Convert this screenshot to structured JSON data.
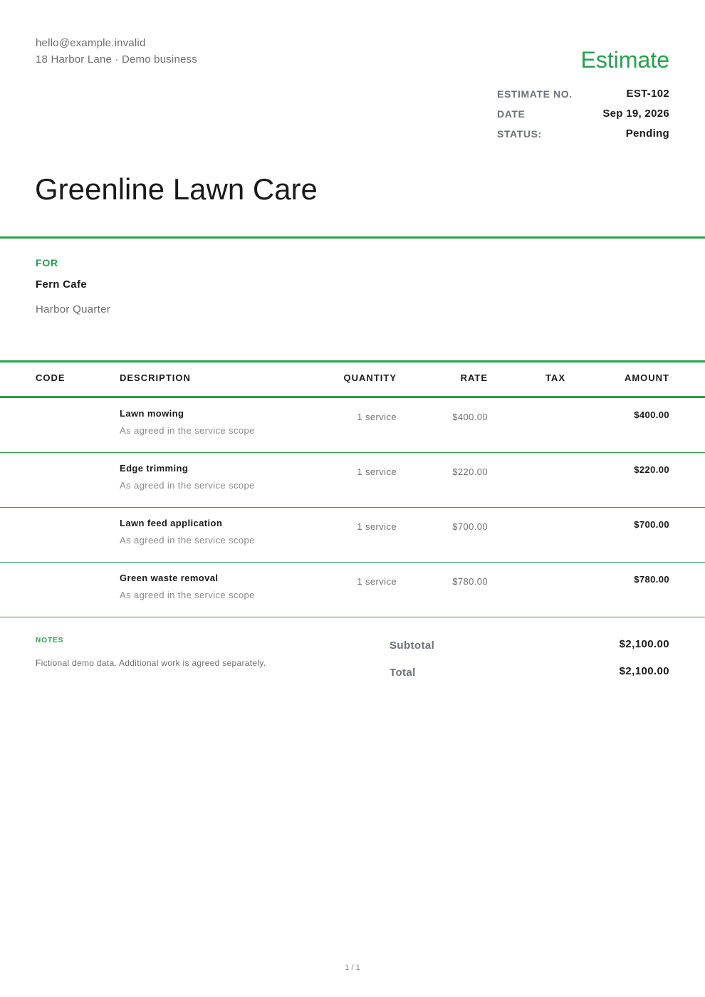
{
  "sender": {
    "email": "hello@example.invalid",
    "address": "18 Harbor Lane · Demo business"
  },
  "document": {
    "title": "Estimate",
    "meta": [
      {
        "label": "ESTIMATE NO.",
        "value": "EST-102"
      },
      {
        "label": "DATE",
        "value": "Sep 19, 2026"
      },
      {
        "label": "STATUS:",
        "value": "Pending"
      }
    ]
  },
  "company": {
    "name": "Greenline Lawn Care"
  },
  "client": {
    "label": "FOR",
    "name": "Fern Cafe",
    "area": "Harbor Quarter"
  },
  "table": {
    "headers": {
      "code": "CODE",
      "description": "DESCRIPTION",
      "quantity": "QUANTITY",
      "rate": "RATE",
      "tax": "TAX",
      "amount": "AMOUNT"
    },
    "rows": [
      {
        "description": "Lawn mowing",
        "subtext": "As agreed in the service scope",
        "quantity": "1 service",
        "rate": "$400.00",
        "amount": "$400.00"
      },
      {
        "description": "Edge trimming",
        "subtext": "As agreed in the service scope",
        "quantity": "1 service",
        "rate": "$220.00",
        "amount": "$220.00"
      },
      {
        "description": "Lawn feed application",
        "subtext": "As agreed in the service scope",
        "quantity": "1 service",
        "rate": "$700.00",
        "amount": "$700.00"
      },
      {
        "description": "Green waste removal",
        "subtext": "As agreed in the service scope",
        "quantity": "1 service",
        "rate": "$780.00",
        "amount": "$780.00"
      }
    ]
  },
  "notes": {
    "label": "NOTES",
    "text": "Fictional demo data. Additional work is agreed separately."
  },
  "totals": {
    "subtotal_label": "Subtotal",
    "subtotal_value": "$2,100.00",
    "total_label": "Total",
    "total_value": "$2,100.00"
  },
  "footer": {
    "page": "1 / 1"
  },
  "colors": {
    "accent": "#22a34a"
  }
}
